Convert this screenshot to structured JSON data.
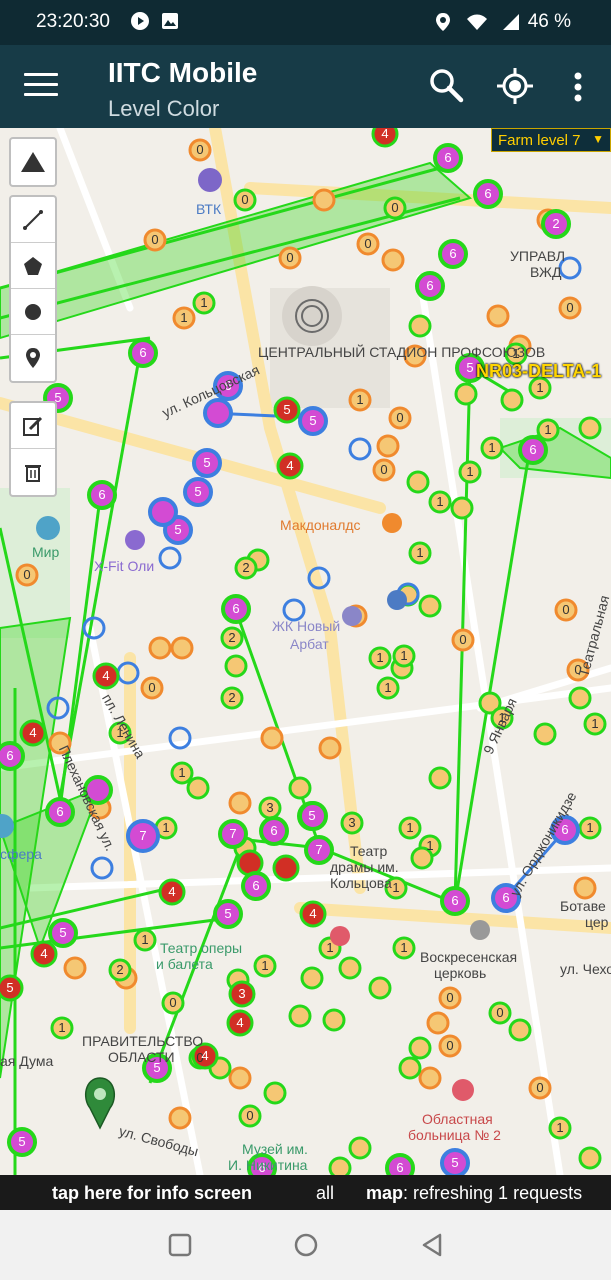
{
  "status_bar": {
    "time": "23:20:30",
    "battery": "46 %",
    "icons": [
      "play-icon",
      "image-icon",
      "location-icon",
      "wifi-icon",
      "signal-icon"
    ]
  },
  "app_bar": {
    "title": "IITC Mobile",
    "subtitle": "Level Color",
    "icons": [
      "menu-icon",
      "search-icon",
      "my-location-icon",
      "more-vertical-icon"
    ]
  },
  "layer_chooser": {
    "label": "Farm level 7",
    "dropdown_icon": "triangle-down-icon"
  },
  "draw_toolbar": [
    "navigation-triangle-icon",
    "draw-polyline-icon",
    "draw-polygon-icon",
    "draw-circle-icon",
    "draw-marker-icon",
    "edit-layers-icon",
    "delete-layers-icon"
  ],
  "portal_label": "NR03-DELTA-1",
  "map_labels": {
    "stadium": "ЦЕНТРАЛЬНЫЙ СТАДИОН ПРОФСОЮЗОВ",
    "vtk": "ВТК",
    "mir": "Мир",
    "xfit": "X-Fit Оли",
    "mcd": "Макдоналдс",
    "arbat1": "ЖК Новый",
    "arbat2": "Арбат",
    "sfera": "сфера",
    "theatre1": "Театр",
    "theatre2": "драмы им.",
    "theatre3": "Кольцова",
    "ballet1": "Театр оперы",
    "ballet2": "и балета",
    "gov1": "ПРАВИТЕЛЬСТВО",
    "gov2": "ОБЛАСТИ",
    "duma": "ая Дума",
    "church1": "Воскресенская",
    "church2": "церковь",
    "hospital1": "Областная",
    "hospital2": "больница № 2",
    "museum1": "Музей им.",
    "museum2": "И. Никитина",
    "upravl1": "УПРАВЛ",
    "upravl2": "ВЖД",
    "bot1": "Ботаве",
    "bot2": "цер",
    "street_koltsovskaya": "ул. Кольцовская",
    "street_svobody": "ул. Свободы",
    "street_ordzho": "ул. Орджоникидзе",
    "street_chehova": "ул. Чехова",
    "street_teatral": "Театральная",
    "street_dekabrya": "9 Января",
    "street_plekh": "Плехановская ул.",
    "street_pl_lenina": "пл. Ленина"
  },
  "info_bar": {
    "tap_text": "tap here for info screen",
    "filter": "all",
    "map_label": "map",
    "map_status": ": refreshing 1 requests"
  },
  "nav_bar": [
    "recents-square-icon",
    "home-circle-icon",
    "back-triangle-icon"
  ],
  "colors": {
    "status_bar": "#0f2a33",
    "app_bar": "#173b47",
    "link_green": "#25d81a",
    "field_green": "#33d61a",
    "portal_level_0": "#f08a2e",
    "portal_level_1": "#f5c774",
    "portal_level_4": "#d12f25",
    "portal_level_5": "#d34bd3",
    "portal_blue": "#3d7fe0",
    "layer_text": "#ffce00"
  }
}
